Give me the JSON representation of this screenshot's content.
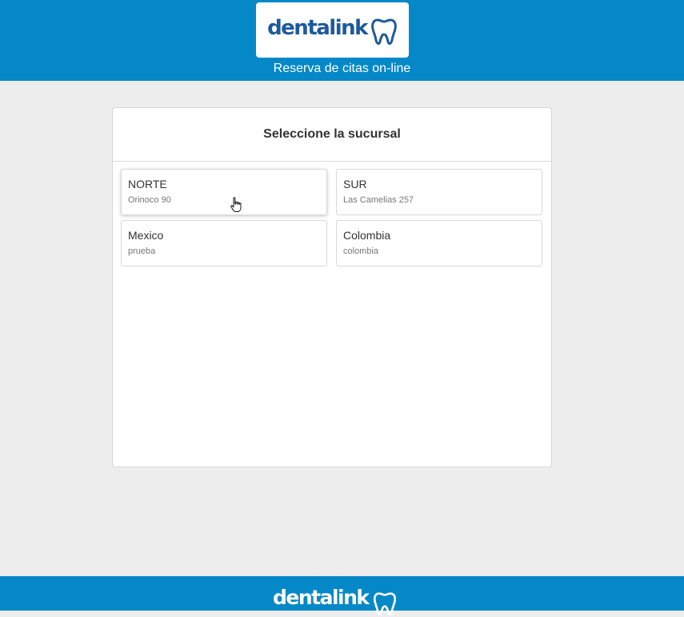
{
  "header": {
    "logo_text": "dentalink",
    "tagline": "Reserva de citas on-line"
  },
  "main": {
    "title": "Seleccione la sucursal",
    "branches": [
      {
        "name": "NORTE",
        "address": "Orinoco 90"
      },
      {
        "name": "SUR",
        "address": "Las Camelias 257"
      },
      {
        "name": "Mexico",
        "address": "prueba"
      },
      {
        "name": "Colombia",
        "address": "colombia"
      }
    ]
  },
  "footer": {
    "logo_text": "dentalink"
  },
  "colors": {
    "brand_blue": "#0488c8",
    "logo_blue": "#1d5a9c",
    "background": "#ededed"
  },
  "icons": [
    "tooth-icon",
    "pointer-hand-icon"
  ]
}
